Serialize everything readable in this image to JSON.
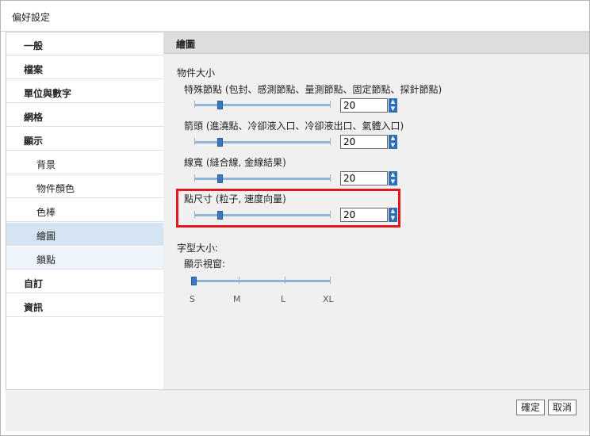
{
  "window": {
    "title": "偏好設定"
  },
  "sidebar": {
    "items": [
      {
        "label": "一般",
        "level": "top"
      },
      {
        "label": "檔案",
        "level": "top"
      },
      {
        "label": "單位與數字",
        "level": "top"
      },
      {
        "label": "網格",
        "level": "top"
      },
      {
        "label": "顯示",
        "level": "top"
      },
      {
        "label": "背景",
        "level": "sub"
      },
      {
        "label": "物件顏色",
        "level": "sub"
      },
      {
        "label": "色棒",
        "level": "sub"
      },
      {
        "label": "繪圖",
        "level": "sub",
        "selected": true
      },
      {
        "label": "鎖點",
        "level": "sub"
      },
      {
        "label": "自訂",
        "level": "top"
      },
      {
        "label": "資訊",
        "level": "top"
      }
    ]
  },
  "panel": {
    "header": "繪圖",
    "object_size": {
      "title": "物件大小",
      "rows": [
        {
          "label": "特殊節點 (包封、感測節點、量測節點、固定節點、探針節點)",
          "value": "20"
        },
        {
          "label": "箭頭 (進澆點、冷卻液入口、冷卻液出口、氣體入口)",
          "value": "20"
        },
        {
          "label": "線寬 (縫合線, 金線結果)",
          "value": "20"
        },
        {
          "label": "點尺寸 (粒子, 速度向量)",
          "value": "20"
        }
      ]
    },
    "font_size": {
      "title": "字型大小:",
      "subtitle": "顯示視窗:",
      "scale": [
        "S",
        "M",
        "L",
        "XL"
      ],
      "selected": "S"
    }
  },
  "footer": {
    "ok_label": "確定",
    "cancel_label": "取消"
  },
  "colors": {
    "accent": "#3a78c0",
    "highlight": "#e0191e",
    "selected_bg": "#d4e4f2"
  }
}
